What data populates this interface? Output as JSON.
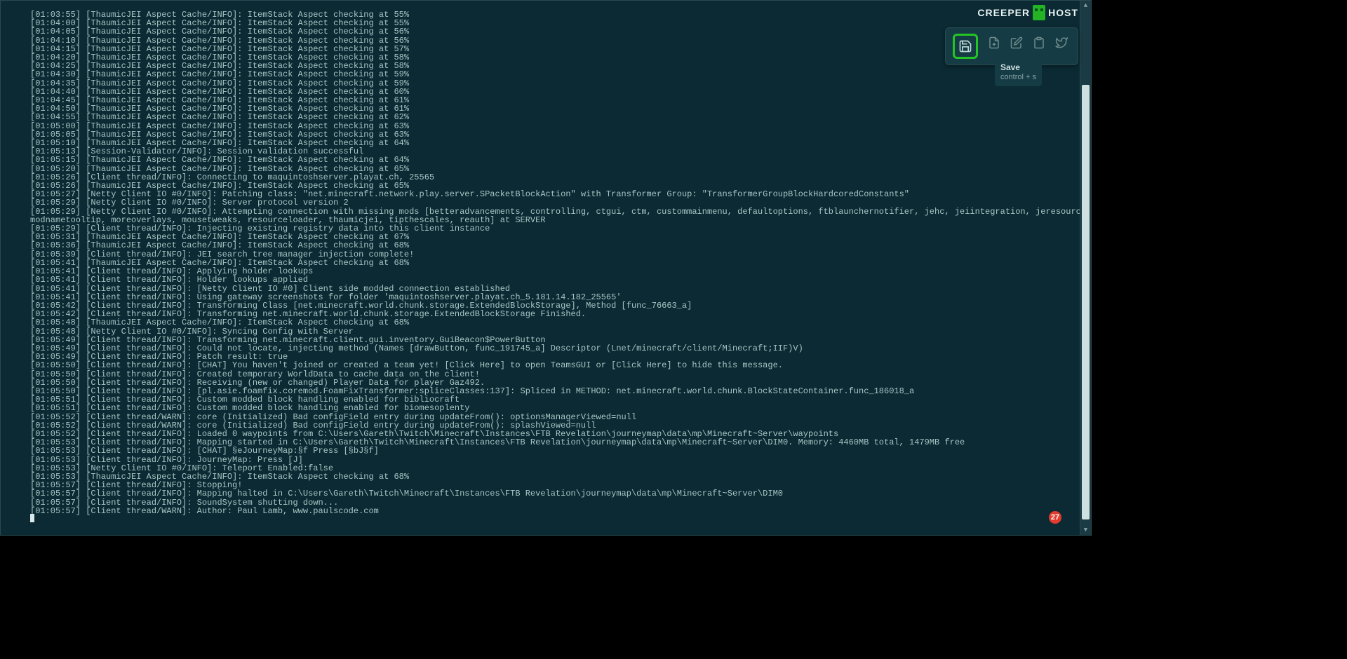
{
  "brand": {
    "left": "CREEPER",
    "right": "HOST"
  },
  "tooltip": {
    "title": "Save",
    "shortcut": "control + s"
  },
  "badge": {
    "count": "27"
  },
  "icons": {
    "save": "save-icon",
    "new": "new-file-icon",
    "edit": "edit-icon",
    "copy": "clipboard-icon",
    "twitter": "twitter-icon"
  },
  "log": [
    "[01:03:55] [ThaumicJEI Aspect Cache/INFO]: ItemStack Aspect checking at 55%",
    "[01:04:00] [ThaumicJEI Aspect Cache/INFO]: ItemStack Aspect checking at 55%",
    "[01:04:05] [ThaumicJEI Aspect Cache/INFO]: ItemStack Aspect checking at 56%",
    "[01:04:10] [ThaumicJEI Aspect Cache/INFO]: ItemStack Aspect checking at 56%",
    "[01:04:15] [ThaumicJEI Aspect Cache/INFO]: ItemStack Aspect checking at 57%",
    "[01:04:20] [ThaumicJEI Aspect Cache/INFO]: ItemStack Aspect checking at 58%",
    "[01:04:25] [ThaumicJEI Aspect Cache/INFO]: ItemStack Aspect checking at 58%",
    "[01:04:30] [ThaumicJEI Aspect Cache/INFO]: ItemStack Aspect checking at 59%",
    "[01:04:35] [ThaumicJEI Aspect Cache/INFO]: ItemStack Aspect checking at 59%",
    "[01:04:40] [ThaumicJEI Aspect Cache/INFO]: ItemStack Aspect checking at 60%",
    "[01:04:45] [ThaumicJEI Aspect Cache/INFO]: ItemStack Aspect checking at 61%",
    "[01:04:50] [ThaumicJEI Aspect Cache/INFO]: ItemStack Aspect checking at 61%",
    "[01:04:55] [ThaumicJEI Aspect Cache/INFO]: ItemStack Aspect checking at 62%",
    "[01:05:00] [ThaumicJEI Aspect Cache/INFO]: ItemStack Aspect checking at 63%",
    "[01:05:05] [ThaumicJEI Aspect Cache/INFO]: ItemStack Aspect checking at 63%",
    "[01:05:10] [ThaumicJEI Aspect Cache/INFO]: ItemStack Aspect checking at 64%",
    "[01:05:13] [Session-Validator/INFO]: Session validation successful",
    "[01:05:15] [ThaumicJEI Aspect Cache/INFO]: ItemStack Aspect checking at 64%",
    "[01:05:20] [ThaumicJEI Aspect Cache/INFO]: ItemStack Aspect checking at 65%",
    "[01:05:26] [Client thread/INFO]: Connecting to maquintoshserver.playat.ch, 25565",
    "[01:05:26] [ThaumicJEI Aspect Cache/INFO]: ItemStack Aspect checking at 65%",
    "[01:05:27] [Netty Client IO #0/INFO]: Patching class: \"net.minecraft.network.play.server.SPacketBlockAction\" with Transformer Group: \"TransformerGroupBlockHardcoredConstants\"",
    "[01:05:29] [Netty Client IO #0/INFO]: Server protocol version 2",
    "[01:05:29] [Netty Client IO #0/INFO]: Attempting connection with missing mods [betteradvancements, controlling, ctgui, ctm, custommainmenu, defaultoptions, ftblaunchernotifier, jehc, jeiintegration, jeresources,",
    "modnametooltip, moreoverlays, mousetweaks, resourceloader, thaumicjei, tipthescales, reauth] at SERVER",
    "[01:05:29] [Client thread/INFO]: Injecting existing registry data into this client instance",
    "[01:05:31] [ThaumicJEI Aspect Cache/INFO]: ItemStack Aspect checking at 67%",
    "[01:05:36] [ThaumicJEI Aspect Cache/INFO]: ItemStack Aspect checking at 68%",
    "[01:05:39] [Client thread/INFO]: JEI search tree manager injection complete!",
    "[01:05:41] [ThaumicJEI Aspect Cache/INFO]: ItemStack Aspect checking at 68%",
    "[01:05:41] [Client thread/INFO]: Applying holder lookups",
    "[01:05:41] [Client thread/INFO]: Holder lookups applied",
    "[01:05:41] [Client thread/INFO]: [Netty Client IO #0] Client side modded connection established",
    "[01:05:41] [Client thread/INFO]: Using gateway screenshots for folder 'maquintoshserver.playat.ch_5.181.14.182_25565'",
    "[01:05:42] [Client thread/INFO]: Transforming Class [net.minecraft.world.chunk.storage.ExtendedBlockStorage], Method [func_76663_a]",
    "[01:05:42] [Client thread/INFO]: Transforming net.minecraft.world.chunk.storage.ExtendedBlockStorage Finished.",
    "[01:05:48] [ThaumicJEI Aspect Cache/INFO]: ItemStack Aspect checking at 68%",
    "[01:05:48] [Netty Client IO #0/INFO]: Syncing Config with Server",
    "[01:05:49] [Client thread/INFO]: Transforming net.minecraft.client.gui.inventory.GuiBeacon$PowerButton",
    "[01:05:49] [Client thread/INFO]: Could not locate, injecting method (Names [drawButton, func_191745_a] Descriptor (Lnet/minecraft/client/Minecraft;IIF)V)",
    "[01:05:49] [Client thread/INFO]: Patch result: true",
    "[01:05:50] [Client thread/INFO]: [CHAT] You haven't joined or created a team yet! [Click Here] to open TeamsGUI or [Click Here] to hide this message.",
    "[01:05:50] [Client thread/INFO]: Created temporary WorldData to cache data on the client!",
    "[01:05:50] [Client thread/INFO]: Receiving (new or changed) Player Data for player Gaz492.",
    "[01:05:50] [Client thread/INFO]: [pl.asie.foamfix.coremod.FoamFixTransformer:spliceClasses:137]: Spliced in METHOD: net.minecraft.world.chunk.BlockStateContainer.func_186018_a",
    "[01:05:51] [Client thread/INFO]: Custom modded block handling enabled for bibliocraft",
    "[01:05:51] [Client thread/INFO]: Custom modded block handling enabled for biomesoplenty",
    "[01:05:52] [Client thread/WARN]: core (Initialized) Bad configField entry during updateFrom(): optionsManagerViewed=null",
    "[01:05:52] [Client thread/WARN]: core (Initialized) Bad configField entry during updateFrom(): splashViewed=null",
    "[01:05:52] [Client thread/INFO]: Loaded 0 waypoints from C:\\Users\\Gareth\\Twitch\\Minecraft\\Instances\\FTB Revelation\\journeymap\\data\\mp\\Minecraft~Server\\waypoints",
    "[01:05:53] [Client thread/INFO]: Mapping started in C:\\Users\\Gareth\\Twitch\\Minecraft\\Instances\\FTB Revelation\\journeymap\\data\\mp\\Minecraft~Server\\DIM0. Memory: 4460MB total, 1479MB free",
    "[01:05:53] [Client thread/INFO]: [CHAT] §eJourneyMap:§f Press [§bJ§f]",
    "[01:05:53] [Client thread/INFO]: JourneyMap: Press [J]",
    "[01:05:53] [Netty Client IO #0/INFO]: Teleport Enabled:false",
    "[01:05:53] [ThaumicJEI Aspect Cache/INFO]: ItemStack Aspect checking at 68%",
    "[01:05:57] [Client thread/INFO]: Stopping!",
    "[01:05:57] [Client thread/INFO]: Mapping halted in C:\\Users\\Gareth\\Twitch\\Minecraft\\Instances\\FTB Revelation\\journeymap\\data\\mp\\Minecraft~Server\\DIM0",
    "[01:05:57] [Client thread/INFO]: SoundSystem shutting down...",
    "[01:05:57] [Client thread/WARN]: Author: Paul Lamb, www.paulscode.com"
  ]
}
